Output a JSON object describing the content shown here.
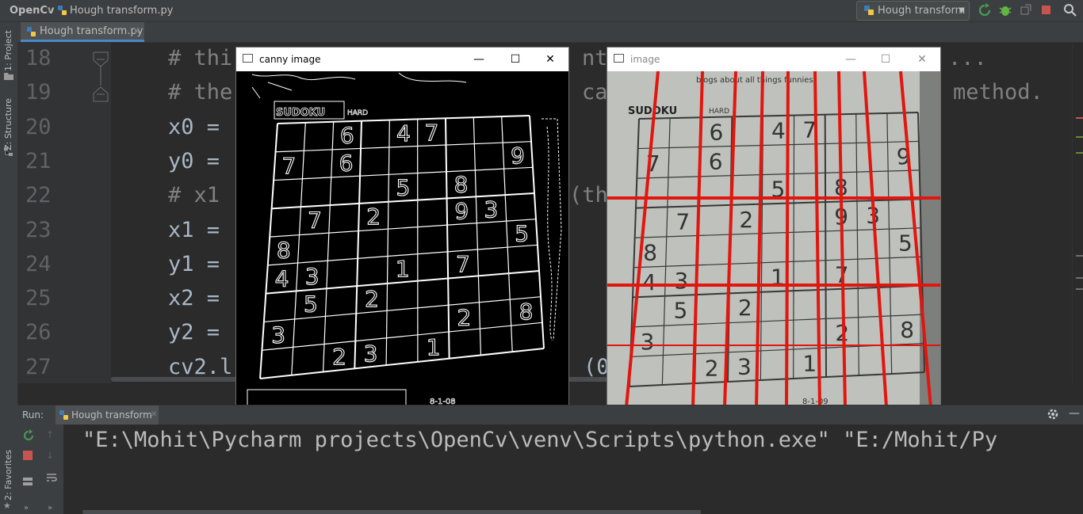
{
  "navbar": {
    "project": "OpenCv",
    "file": "Hough transform.py",
    "run_config": "Hough transform"
  },
  "editor_tab": {
    "label": "Hough transform.py"
  },
  "left_strip": {
    "project": "1: Project",
    "structure": "Z: Structure",
    "favorites": "2: Favorites"
  },
  "editor": {
    "lines": [
      {
        "num": "18",
        "text": "# thi",
        "kind": "cmt",
        "tail": "nt",
        "tail_kind": "cmt",
        "end": "...",
        "end_kind": "cmt"
      },
      {
        "num": "19",
        "text": "# the",
        "kind": "cmt",
        "tail": "ca",
        "tail_kind": "cmt",
        "end": "method.",
        "end_kind": "cmt"
      },
      {
        "num": "20",
        "text": "x0 =",
        "kind": "txt",
        "tail": "",
        "tail_kind": "txt",
        "end": "",
        "end_kind": "txt"
      },
      {
        "num": "21",
        "text": "y0 =",
        "kind": "txt",
        "tail": "",
        "tail_kind": "txt",
        "end": "",
        "end_kind": "txt"
      },
      {
        "num": "22",
        "text": "# x1",
        "kind": "cmt",
        "tail": "(th",
        "tail_kind": "cmt",
        "end": "",
        "end_kind": "txt"
      },
      {
        "num": "23",
        "text": "x1 =",
        "kind": "txt",
        "tail": "",
        "tail_kind": "txt",
        "end": "",
        "end_kind": "txt"
      },
      {
        "num": "24",
        "text": "y1 =",
        "kind": "txt",
        "tail": "",
        "tail_kind": "txt",
        "end": "",
        "end_kind": "txt"
      },
      {
        "num": "25",
        "text": "x2 =",
        "kind": "txt",
        "tail": "",
        "tail_kind": "txt",
        "end": "",
        "end_kind": "txt"
      },
      {
        "num": "26",
        "text": "y2 =",
        "kind": "txt",
        "tail": "",
        "tail_kind": "txt",
        "end": "",
        "end_kind": "txt"
      },
      {
        "num": "27",
        "text": "cv2.l",
        "kind": "txt",
        "tail": "(0",
        "tail_kind": "txt",
        "end": "",
        "end_kind": "txt"
      }
    ]
  },
  "canny_window": {
    "title": "canny image",
    "minimize": "—",
    "maximize": "☐",
    "close": "✕",
    "header": "SUDOKU",
    "level": "HARD",
    "footer": "8-1-08",
    "grid": [
      [
        "",
        "",
        "6",
        "",
        "4",
        "7",
        "",
        "",
        ""
      ],
      [
        "7",
        "",
        "6",
        "",
        "",
        "",
        "",
        "",
        "9"
      ],
      [
        "",
        "",
        "",
        "",
        "5",
        "",
        "8",
        "",
        ""
      ],
      [
        "",
        "7",
        "",
        "2",
        "",
        "",
        "9",
        "3",
        ""
      ],
      [
        "8",
        "",
        "",
        "",
        "",
        "",
        "",
        "",
        "5"
      ],
      [
        "4",
        "3",
        "",
        "",
        "1",
        "",
        "7",
        "",
        ""
      ],
      [
        "",
        "5",
        "",
        "2",
        "",
        "",
        "",
        "",
        ""
      ],
      [
        "3",
        "",
        "",
        "",
        "",
        "",
        "2",
        "",
        "8"
      ],
      [
        "",
        "",
        "2",
        "3",
        "",
        "1",
        "",
        "",
        ""
      ]
    ]
  },
  "image_window": {
    "title": "image",
    "minimize": "—",
    "maximize": "☐",
    "close": "✕",
    "header": "SUDOKU",
    "level": "HARD",
    "top_text": "blogs about all things funnies.",
    "footer": "8-1-09",
    "line_color": "#e0160f",
    "grid": [
      [
        "",
        "",
        "6",
        "",
        "4",
        "7",
        "",
        "",
        ""
      ],
      [
        "7",
        "",
        "6",
        "",
        "",
        "",
        "",
        "",
        "9"
      ],
      [
        "",
        "",
        "",
        "",
        "5",
        "",
        "8",
        "",
        ""
      ],
      [
        "",
        "7",
        "",
        "2",
        "",
        "",
        "9",
        "3",
        ""
      ],
      [
        "8",
        "",
        "",
        "",
        "",
        "",
        "",
        "",
        "5"
      ],
      [
        "4",
        "3",
        "",
        "",
        "1",
        "",
        "7",
        "",
        ""
      ],
      [
        "",
        "5",
        "",
        "2",
        "",
        "",
        "",
        "",
        ""
      ],
      [
        "3",
        "",
        "",
        "",
        "",
        "",
        "2",
        "",
        "8"
      ],
      [
        "",
        "",
        "2",
        "3",
        "",
        "1",
        "",
        "",
        ""
      ]
    ]
  },
  "run_panel": {
    "label": "Run:",
    "tab": "Hough transform",
    "output": "\"E:\\Mohit\\Pycharm projects\\OpenCv\\venv\\Scripts\\python.exe\" \"E:/Mohit/Py"
  },
  "colors": {
    "accent": "#4a88c7",
    "run_green": "#499c54",
    "stop_red": "#c75450",
    "debug_green": "#62b543"
  }
}
